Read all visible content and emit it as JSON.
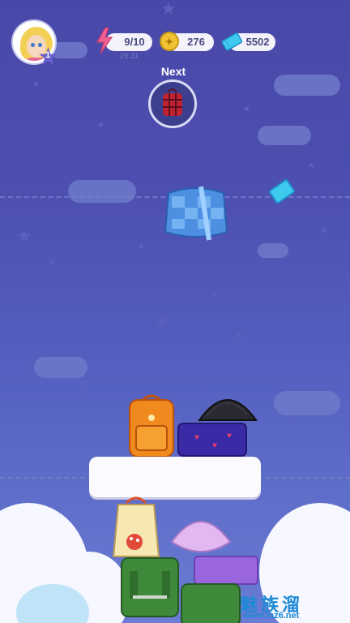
{
  "hud": {
    "player_level": "1",
    "energy": "9/10",
    "energy_timer": "29:31",
    "coins": "276",
    "tickets": "5502"
  },
  "next": {
    "label": "Next",
    "item_icon": "plaid-backpack-icon"
  },
  "falling_item": {
    "icon": "blue-checkered-messenger-bag-icon"
  },
  "floating_pickup": {
    "icon": "ticket-icon"
  },
  "stack_items": [
    "orange-backpack-icon",
    "black-mesh-bag-icon",
    "purple-heart-bag-icon",
    "mushroom-bucket-bag-icon",
    "lavender-hobo-bag-icon",
    "green-backpack-icon",
    "purple-handbag-icon"
  ],
  "watermark": {
    "text": "魅族溜",
    "url": "www.mz6.net"
  },
  "colors": {
    "background": "#4d4fb0",
    "accent": "#f1c232",
    "ticket": "#3ec9ef",
    "energy": "#f06090"
  }
}
